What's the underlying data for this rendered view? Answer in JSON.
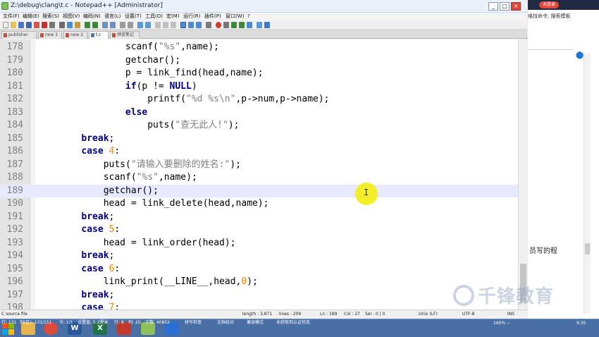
{
  "window": {
    "title": "Z:\\debug\\clang\\t.c - Notepad++ [Administrator]",
    "controls": [
      "_",
      "□",
      "×"
    ]
  },
  "menu": [
    "文件(F)",
    "编辑(E)",
    "搜索(S)",
    "视图(V)",
    "编码(N)",
    "语言(L)",
    "设置(T)",
    "工具(O)",
    "宏(M)",
    "运行(R)",
    "插件(P)",
    "窗口(W)",
    "?"
  ],
  "tabs": [
    {
      "label": "publisher"
    },
    {
      "label": "new 1"
    },
    {
      "label": "new 2"
    },
    {
      "label": "t.c",
      "active": true
    },
    {
      "label": "预览笔记"
    }
  ],
  "editor": {
    "current_line": 189,
    "lines": [
      {
        "n": "178",
        "code": [
          [
            "plain",
            "    scanf("
          ],
          [
            "str",
            "\"%s\""
          ],
          [
            "plain",
            ",name);"
          ]
        ],
        "indent": 3
      },
      {
        "n": "179",
        "code": [
          [
            "plain",
            "    getchar();"
          ]
        ],
        "indent": 3
      },
      {
        "n": "180",
        "code": [
          [
            "plain",
            "    p = link_find(head,name);"
          ]
        ],
        "indent": 3
      },
      {
        "n": "181",
        "code": [
          [
            "plain",
            "    "
          ],
          [
            "kw",
            "if"
          ],
          [
            "plain",
            "(p != "
          ],
          [
            "kw",
            "NULL"
          ],
          [
            "plain",
            ")"
          ]
        ],
        "indent": 3
      },
      {
        "n": "182",
        "code": [
          [
            "plain",
            "        printf("
          ],
          [
            "str",
            "\"%d %s\\n\""
          ],
          [
            "plain",
            ",p->num,p->name);"
          ]
        ],
        "indent": 3
      },
      {
        "n": "183",
        "code": [
          [
            "plain",
            "    "
          ],
          [
            "kw",
            "else"
          ]
        ],
        "indent": 3
      },
      {
        "n": "184",
        "code": [
          [
            "plain",
            "        puts("
          ],
          [
            "str",
            "\"查无此人!\""
          ],
          [
            "plain",
            ");"
          ]
        ],
        "indent": 3
      },
      {
        "n": "185",
        "code": [
          [
            "kw",
            "break"
          ],
          [
            "plain",
            ";"
          ]
        ],
        "indent": 2
      },
      {
        "n": "186",
        "code": [
          [
            "kw",
            "case"
          ],
          [
            "plain",
            " "
          ],
          [
            "num",
            "4"
          ],
          [
            "plain",
            ":"
          ]
        ],
        "indent": 2
      },
      {
        "n": "187",
        "code": [
          [
            "plain",
            "    puts("
          ],
          [
            "str",
            "\"请输入要删除的姓名:\""
          ],
          [
            "plain",
            ");"
          ]
        ],
        "indent": 2
      },
      {
        "n": "188",
        "code": [
          [
            "plain",
            "    scanf("
          ],
          [
            "str",
            "\"%s\""
          ],
          [
            "plain",
            ",name);"
          ]
        ],
        "indent": 2
      },
      {
        "n": "189",
        "code": [
          [
            "plain",
            "    getchar();"
          ]
        ],
        "indent": 2
      },
      {
        "n": "190",
        "code": [
          [
            "plain",
            "    head = link_delete(head,name);"
          ]
        ],
        "indent": 2
      },
      {
        "n": "191",
        "code": [
          [
            "kw",
            "break"
          ],
          [
            "plain",
            ";"
          ]
        ],
        "indent": 2
      },
      {
        "n": "192",
        "code": [
          [
            "kw",
            "case"
          ],
          [
            "plain",
            " "
          ],
          [
            "num",
            "5"
          ],
          [
            "plain",
            ":"
          ]
        ],
        "indent": 2
      },
      {
        "n": "193",
        "code": [
          [
            "plain",
            "    head = link_order(head);"
          ]
        ],
        "indent": 2
      },
      {
        "n": "194",
        "code": [
          [
            "kw",
            "break"
          ],
          [
            "plain",
            ";"
          ]
        ],
        "indent": 2
      },
      {
        "n": "195",
        "code": [
          [
            "kw",
            "case"
          ],
          [
            "plain",
            " "
          ],
          [
            "num",
            "6"
          ],
          [
            "plain",
            ":"
          ]
        ],
        "indent": 2
      },
      {
        "n": "196",
        "code": [
          [
            "plain",
            "    link_print(__LINE__,head,"
          ],
          [
            "num",
            "0"
          ],
          [
            "plain",
            ");"
          ]
        ],
        "indent": 2
      },
      {
        "n": "197",
        "code": [
          [
            "kw",
            "break"
          ],
          [
            "plain",
            ";"
          ]
        ],
        "indent": 2
      },
      {
        "n": "198",
        "code": [
          [
            "kw",
            "case"
          ],
          [
            "plain",
            " "
          ],
          [
            "num",
            "7"
          ],
          [
            "plain",
            ":"
          ]
        ],
        "indent": 2
      }
    ]
  },
  "status": {
    "file_type": "C source file",
    "length": "length : 3,871",
    "lines": "lines : 209",
    "ln": "Ln : 189",
    "col": "Col : 27",
    "sel": "Sel : 0 | 0",
    "eol": "Unix (LF)",
    "encoding": "UTF-8",
    "mode": "INS"
  },
  "right_app": {
    "login_badge": "未登录",
    "search_hint": "维找命令, 搜索模板",
    "body_text": "员写的程",
    "watermark": "千锋教育"
  },
  "ime_bar": [
    "行: 131",
    "列(区): 131/151",
    "节: 1/1",
    "设置值: 5.2厘米",
    "行: 8",
    "列: 20",
    "字数: 40852",
    "拼写检查",
    "文档校对",
    "兼容模式",
    "未获取到认证状态"
  ],
  "taskbar": {
    "zoom": "160% −",
    "time": "9:35",
    "apps": [
      "文件夹",
      "Chrome",
      "Word",
      "Excel",
      "Notepad++"
    ]
  },
  "colors": {
    "keyword": "#00008b",
    "string": "#808080",
    "number": "#ff8000",
    "current_line": "#e8e8ff",
    "cursor_highlight": "#f4ee18"
  }
}
